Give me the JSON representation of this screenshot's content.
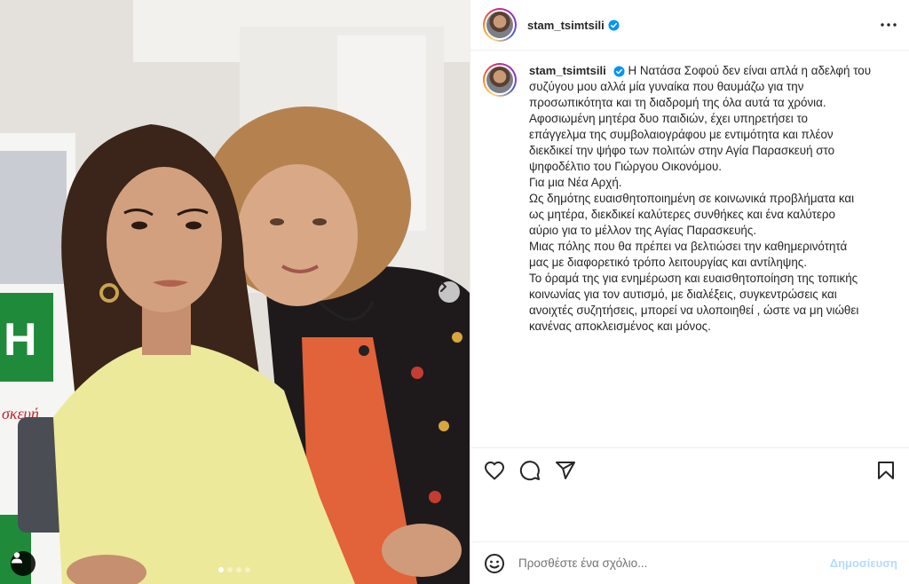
{
  "post": {
    "username": "stam_tsimtsili",
    "more_icon": "more-horizontal-icon",
    "caption_lines": [
      "Η Νατάσα Σοφού δεν είναι απλά η αδελφή του",
      "συζύγου μου αλλά μία γυναίκα που θαυμάζω για την",
      "προσωπικότητα και τη διαδρομή της όλα αυτά τα χρόνια.",
      "Αφοσιωμένη μητέρα δυο παιδιών, έχει υπηρετήσει το",
      "επάγγελμα της συμβολαιογράφου με εντιμότητα και πλέον",
      "διεκδικεί την ψήφο των πολιτών στην Αγία Παρασκευή στο",
      "ψηφοδέλτιο του Γιώργου Οικονόμου.",
      "Για μια Νέα Αρχή.",
      "Ως δημότης ευαισθητοποιημένη σε κοινωνικά προβλήματα και",
      "ως μητέρα, διεκδικεί καλύτερες συνθήκες και ένα καλύτερο",
      "αύριο για το μέλλον της Αγίας Παρασκευής.",
      "Μιας πόλης που θα πρέπει να βελτιώσει την καθημερινότητά",
      "μας με διαφορετικό τρόπο λειτουργίας και αντίληψης.",
      "Το όραμά της για ενημέρωση και ευαισθητοποίηση της τοπικής",
      "κοινωνίας για τον αυτισμό, με διαλέξεις, συγκεντρώσεις και",
      "ανοιχτές συζητήσεις, μπορεί να υλοποιηθεί , ώστε να μη νιώθει",
      "κανένας αποκλεισμένος και μόνος."
    ]
  },
  "carousel": {
    "total_slides": 4,
    "active_slide": 1
  },
  "comment": {
    "placeholder": "Προσθέστε ένα σχόλιο...",
    "post_label": "Δημοσίευση"
  },
  "colors": {
    "verified": "#0095f6",
    "post_disabled": "#b3dbff",
    "border": "#efefef"
  }
}
